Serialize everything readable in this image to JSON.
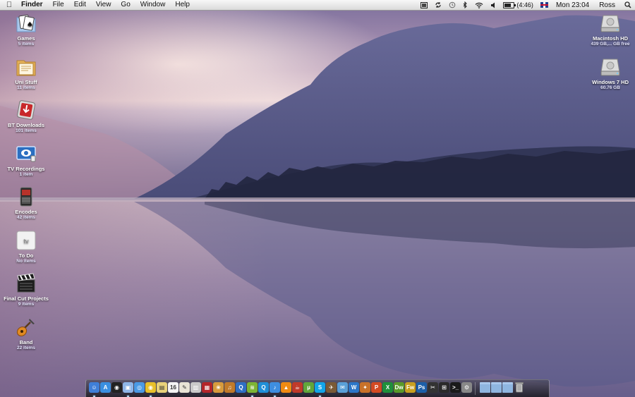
{
  "menubar": {
    "app_name": "Finder",
    "menus": [
      "File",
      "Edit",
      "View",
      "Go",
      "Window",
      "Help"
    ],
    "battery_text": "(4:46)",
    "battery_level": 0.75,
    "clock": "Mon 23:04",
    "user": "Ross",
    "status_icons": [
      "sync-icon",
      "time-machine-icon",
      "bluetooth-icon",
      "wifi-icon",
      "volume-icon",
      "battery-icon",
      "uk-flag-icon",
      "spotlight-icon"
    ]
  },
  "desktop": {
    "left_icons": [
      {
        "name": "Games",
        "sub": "5 items",
        "icon": "games-folder-icon"
      },
      {
        "name": "Uni Stuff",
        "sub": "11 items",
        "icon": "uni-folder-icon"
      },
      {
        "name": "BT Downloads",
        "sub": "101 items",
        "icon": "bt-downloads-folder-icon"
      },
      {
        "name": "TV Recordings",
        "sub": "1 item",
        "icon": "tv-recordings-folder-icon"
      },
      {
        "name": "Encodes",
        "sub": "42 items",
        "icon": "encodes-folder-icon"
      },
      {
        "name": "To Do",
        "sub": "No items",
        "icon": "appletv-folder-icon"
      },
      {
        "name": "Final Cut Projects",
        "sub": "9 items",
        "icon": "final-cut-folder-icon"
      },
      {
        "name": "Band",
        "sub": "22 items",
        "icon": "guitar-folder-icon"
      }
    ],
    "right_icons": [
      {
        "name": "Macintosh HD",
        "sub": "439 GB,... GB free",
        "icon": "hard-drive-icon"
      },
      {
        "name": "Windows 7 HD",
        "sub": "60.76 GB",
        "icon": "hard-drive-icon"
      }
    ]
  },
  "dock": {
    "apps": [
      {
        "icon": "finder-icon",
        "color": "#3f7fd8",
        "glyph": "☺",
        "running": true
      },
      {
        "icon": "app-store-icon",
        "color": "#3a8fe0",
        "glyph": "A",
        "running": false
      },
      {
        "icon": "dashboard-icon",
        "color": "#222222",
        "glyph": "◉",
        "running": false
      },
      {
        "icon": "preview-icon",
        "color": "#8fb6e8",
        "glyph": "▣",
        "running": true
      },
      {
        "icon": "safari-icon",
        "color": "#4a9ae5",
        "glyph": "◎",
        "running": false
      },
      {
        "icon": "chrome-icon",
        "color": "#e8c02a",
        "glyph": "◉",
        "running": true
      },
      {
        "icon": "stickies-icon",
        "color": "#e8d27a",
        "glyph": "▤",
        "running": false
      },
      {
        "icon": "calendar-icon",
        "color": "#f4f4f4",
        "glyph": "16",
        "running": false
      },
      {
        "icon": "textedit-icon",
        "color": "#e9e4d6",
        "glyph": "✎",
        "running": false
      },
      {
        "icon": "image-capture-icon",
        "color": "#c9c9c9",
        "glyph": "▥",
        "running": false
      },
      {
        "icon": "photo-booth-icon",
        "color": "#b3252a",
        "glyph": "▦",
        "running": false
      },
      {
        "icon": "iphoto-icon",
        "color": "#d79b3c",
        "glyph": "❀",
        "running": false
      },
      {
        "icon": "garageband-icon",
        "color": "#c07a2a",
        "glyph": "♫",
        "running": false
      },
      {
        "icon": "quicktime-icon",
        "color": "#2e6fc4",
        "glyph": "Q",
        "running": false
      },
      {
        "icon": "spotify-icon",
        "color": "#7db534",
        "glyph": "≋",
        "running": true
      },
      {
        "icon": "quicksilver-icon",
        "color": "#1f8fd8",
        "glyph": "Q",
        "running": false
      },
      {
        "icon": "itunes-icon",
        "color": "#3e8ee0",
        "glyph": "♪",
        "running": true
      },
      {
        "icon": "vlc-icon",
        "color": "#f08a12",
        "glyph": "▲",
        "running": false
      },
      {
        "icon": "handbrake-icon",
        "color": "#c03a2a",
        "glyph": "☕",
        "running": false
      },
      {
        "icon": "utorrent-icon",
        "color": "#61a63a",
        "glyph": "µ",
        "running": false
      },
      {
        "icon": "skype-icon",
        "color": "#12a5e8",
        "glyph": "S",
        "running": true
      },
      {
        "icon": "cyberduck-icon",
        "color": "#7a5a36",
        "glyph": "✈",
        "running": false
      },
      {
        "icon": "mail-icon",
        "color": "#5aa0d8",
        "glyph": "✉",
        "running": false
      },
      {
        "icon": "wunderlist-icon",
        "color": "#2c76c8",
        "glyph": "W",
        "running": false
      },
      {
        "icon": "textwrangler-icon",
        "color": "#c8722a",
        "glyph": "✦",
        "running": false
      },
      {
        "icon": "powerpoint-icon",
        "color": "#d34a22",
        "glyph": "P",
        "running": false
      },
      {
        "icon": "excel-icon",
        "color": "#1f8f3a",
        "glyph": "X",
        "running": false
      },
      {
        "icon": "dreamweaver-icon",
        "color": "#5a9a2a",
        "glyph": "Dw",
        "running": false
      },
      {
        "icon": "fireworks-icon",
        "color": "#c8a020",
        "glyph": "Fw",
        "running": false
      },
      {
        "icon": "photoshop-icon",
        "color": "#1c5fa8",
        "glyph": "Ps",
        "running": false
      },
      {
        "icon": "final-cut-icon",
        "color": "#333333",
        "glyph": "✂",
        "running": false
      },
      {
        "icon": "activity-monitor-icon",
        "color": "#2a2a2a",
        "glyph": "⊞",
        "running": false
      },
      {
        "icon": "terminal-icon",
        "color": "#1a1a1a",
        "glyph": ">_",
        "running": false
      },
      {
        "icon": "system-preferences-icon",
        "color": "#888888",
        "glyph": "⚙",
        "running": false
      }
    ],
    "stacks": [
      {
        "icon": "applications-stack-icon",
        "color": "#8fb6e0"
      },
      {
        "icon": "documents-stack-icon",
        "color": "#8fb6e0"
      },
      {
        "icon": "downloads-stack-icon",
        "color": "#8fb6e0"
      },
      {
        "icon": "trash-icon",
        "color": "#9a9a9a"
      }
    ]
  }
}
